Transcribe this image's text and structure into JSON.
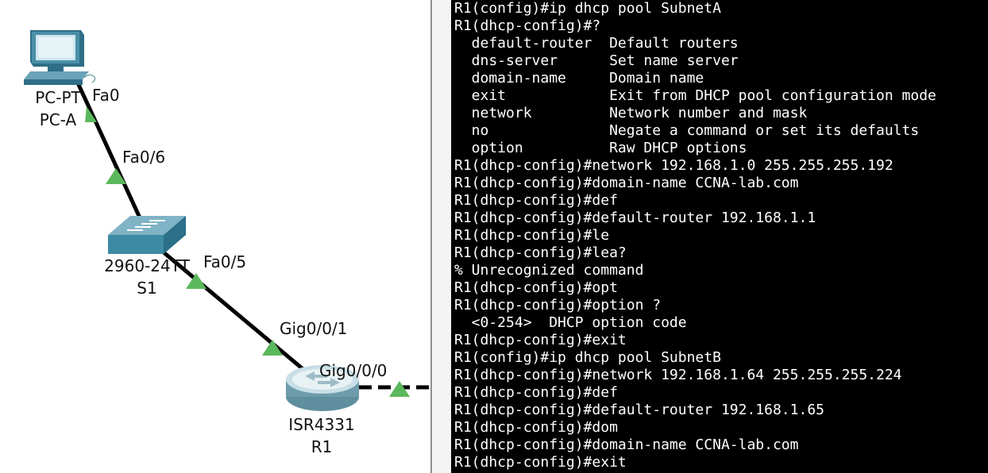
{
  "topology": {
    "devices": [
      {
        "name": "PC-A",
        "model": "PC-PT",
        "type": "pc"
      },
      {
        "name": "S1",
        "model": "2960-24TT",
        "type": "switch"
      },
      {
        "name": "R1",
        "model": "ISR4331",
        "type": "router"
      }
    ],
    "port_labels": {
      "pc_fa0": "Fa0",
      "s1_fa0_6": "Fa0/6",
      "s1_fa0_5": "Fa0/5",
      "r1_gig0_0_1": "Gig0/0/1",
      "r1_gig0_0_0": "Gig0/0/0"
    },
    "colors": {
      "link": "#000000",
      "link_up": "#5cb85c",
      "device": "#4a8fa8"
    }
  },
  "terminal": {
    "lines": [
      "R1(config)#ip dhcp pool SubnetA",
      "R1(dhcp-config)#?",
      "  default-router  Default routers",
      "  dns-server      Set name server",
      "  domain-name     Domain name",
      "  exit            Exit from DHCP pool configuration mode",
      "  network         Network number and mask",
      "  no              Negate a command or set its defaults",
      "  option          Raw DHCP options",
      "R1(dhcp-config)#network 192.168.1.0 255.255.255.192",
      "R1(dhcp-config)#domain-name CCNA-lab.com",
      "R1(dhcp-config)#def",
      "R1(dhcp-config)#default-router 192.168.1.1",
      "R1(dhcp-config)#le",
      "R1(dhcp-config)#lea?",
      "% Unrecognized command",
      "R1(dhcp-config)#opt",
      "R1(dhcp-config)#option ?",
      "  <0-254>  DHCP option code",
      "R1(dhcp-config)#exit",
      "R1(config)#ip dhcp pool SubnetB",
      "R1(dhcp-config)#network 192.168.1.64 255.255.255.224",
      "R1(dhcp-config)#def",
      "R1(dhcp-config)#default-router 192.168.1.65",
      "R1(dhcp-config)#dom",
      "R1(dhcp-config)#domain-name CCNA-lab.com",
      "R1(dhcp-config)#exit"
    ]
  }
}
